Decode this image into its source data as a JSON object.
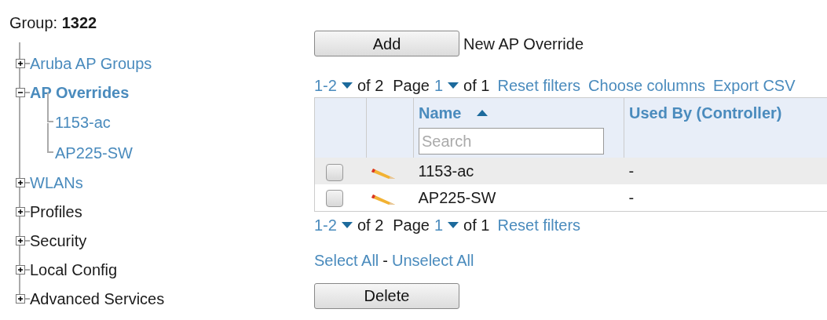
{
  "group": {
    "label": "Group:",
    "value": "1322"
  },
  "tree": [
    {
      "label": "Aruba AP Groups",
      "link": true,
      "bold": false,
      "expanded": false
    },
    {
      "label": "AP Overrides",
      "link": true,
      "bold": true,
      "expanded": true,
      "children": [
        {
          "label": "1153-ac"
        },
        {
          "label": "AP225-SW"
        }
      ]
    },
    {
      "label": "WLANs",
      "link": true,
      "bold": false,
      "expanded": false
    },
    {
      "label": "Profiles",
      "link": false,
      "bold": false,
      "expanded": false
    },
    {
      "label": "Security",
      "link": false,
      "bold": false,
      "expanded": false
    },
    {
      "label": "Local Config",
      "link": false,
      "bold": false,
      "expanded": false
    },
    {
      "label": "Advanced Services",
      "link": false,
      "bold": false,
      "expanded": false
    }
  ],
  "add": {
    "button": "Add",
    "description": "New AP Override"
  },
  "pager_top": {
    "range": "1-2",
    "total": "of 2",
    "page_label": "Page",
    "page": "1",
    "pages": "of 1",
    "links": [
      "Reset filters",
      "Choose columns",
      "Export CSV"
    ]
  },
  "table": {
    "columns": [
      {
        "label": "Name",
        "sorted": true,
        "search_placeholder": "Search"
      },
      {
        "label": "Used By (Controller)"
      }
    ],
    "rows": [
      {
        "checked": false,
        "name": "1153-ac",
        "used_by": "-"
      },
      {
        "checked": false,
        "name": "AP225-SW",
        "used_by": "-"
      }
    ]
  },
  "pager_bottom": {
    "range": "1-2",
    "total": "of 2",
    "page_label": "Page",
    "page": "1",
    "pages": "of 1",
    "links": [
      "Reset filters"
    ]
  },
  "selection": {
    "select_all": "Select All",
    "separator": "-",
    "unselect_all": "Unselect All"
  },
  "delete_button": "Delete"
}
